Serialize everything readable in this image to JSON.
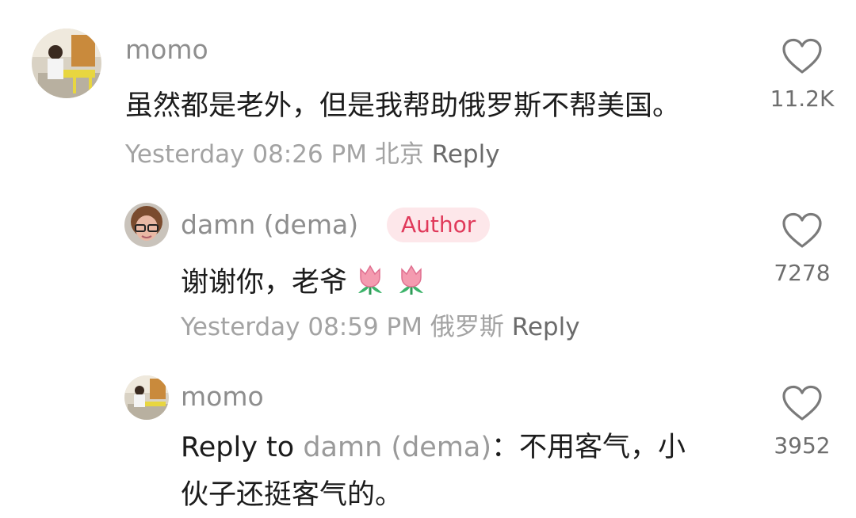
{
  "comments": [
    {
      "username": "momo",
      "text": "虽然都是老外，但是我帮助俄罗斯不帮美国。",
      "timestamp": "Yesterday 08:26 PM",
      "location": "北京",
      "reply_label": "Reply",
      "likes": "11.2K"
    },
    {
      "username": "damn (dema)",
      "badge": "Author",
      "text": "谢谢你，老爷",
      "emojis": [
        "tulip-emoji",
        "tulip-emoji"
      ],
      "timestamp": "Yesterday 08:59 PM",
      "location": "俄罗斯",
      "reply_label": "Reply",
      "likes": "7278"
    },
    {
      "username": "momo",
      "reply_prefix": "Reply to",
      "reply_target": "damn (dema)",
      "separator": "：",
      "text_line1": "不用客气，小",
      "text_line2": "伙子还挺客气的。",
      "likes": "3952"
    }
  ],
  "icons": {
    "like": "heart-outline-icon"
  },
  "colors": {
    "username": "#8e8e8e",
    "text": "#1c1c1c",
    "meta": "#a3a3a3",
    "badge_bg": "#fde7ea",
    "badge_text": "#e0395a"
  }
}
